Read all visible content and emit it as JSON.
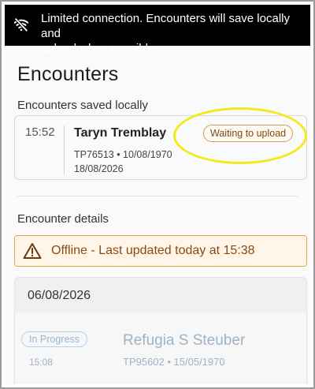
{
  "banner": {
    "line1": "Limited connection. Encounters will save locally and",
    "line2": "upload when possible",
    "icon": "wifi-off-icon"
  },
  "page": {
    "title": "Encounters"
  },
  "local": {
    "label": "Encounters saved locally",
    "encounter": {
      "time": "15:52",
      "name": "Taryn Tremblay",
      "id_dob": "TP76513 • 10/08/1970",
      "date": "18/08/2026",
      "status": "Waiting to upload"
    }
  },
  "details": {
    "label": "Encounter details",
    "offline_message": "Offline - Last updated today at 15:38",
    "date_header": "06/08/2026",
    "encounter": {
      "status": "In Progress",
      "time": "15:08",
      "name": "Refugia S Steuber",
      "id_dob": "TP95602 • 15/05/1970"
    }
  },
  "colors": {
    "banner_bg": "#000000",
    "warning_border": "#e0a64c",
    "warning_bg": "#fff6e9",
    "highlight": "#f2ea1a"
  }
}
